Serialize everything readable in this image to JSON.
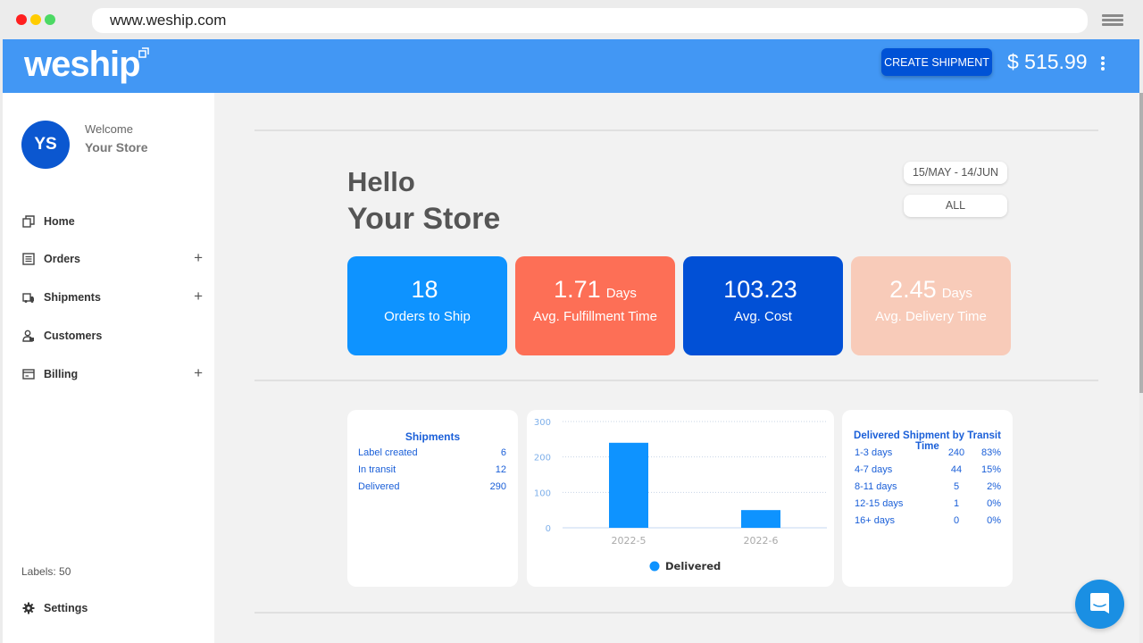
{
  "browser": {
    "url": "www.weship.com"
  },
  "appbar": {
    "logo": "weship",
    "create_shipment_label": "CREATE SHIPMENT",
    "balance": "$ 515.99"
  },
  "sidebar": {
    "avatar_initials": "YS",
    "welcome": "Welcome",
    "store_name": "Your Store",
    "items": [
      {
        "label": "Home",
        "icon": "home-icon",
        "expandable": false
      },
      {
        "label": "Orders",
        "icon": "orders-icon",
        "expandable": true
      },
      {
        "label": "Shipments",
        "icon": "truck-icon",
        "expandable": true
      },
      {
        "label": "Customers",
        "icon": "customers-icon",
        "expandable": false
      },
      {
        "label": "Billing",
        "icon": "billing-icon",
        "expandable": true
      }
    ],
    "expand_symbol": "+",
    "labels_count": "Labels: 50",
    "settings_label": "Settings"
  },
  "main": {
    "greeting": "Hello",
    "store_name": "Your Store",
    "date_range": "15/MAY - 14/JUN",
    "filter": "ALL",
    "stats": [
      {
        "value": "18",
        "unit": "",
        "label": "Orders to Ship",
        "color": "#0e93ff"
      },
      {
        "value": "1.71",
        "unit": "Days",
        "label": "Avg. Fulfillment Time",
        "color": "#fd6f56"
      },
      {
        "value": "103.23",
        "unit": "",
        "label": "Avg. Cost",
        "color": "#0150d6"
      },
      {
        "value": "2.45",
        "unit": "Days",
        "label": "Avg. Delivery Time",
        "color": "#f8cbb9"
      }
    ],
    "shipments_panel": {
      "title": "Shipments",
      "rows": [
        {
          "label": "Label created",
          "value": "6"
        },
        {
          "label": "In transit",
          "value": "12"
        },
        {
          "label": "Delivered",
          "value": "290"
        }
      ]
    },
    "transit_panel": {
      "title": "Delivered Shipment by Transit Time",
      "rows": [
        {
          "range": "1-3 days",
          "count": "240",
          "percent": "83%"
        },
        {
          "range": "4-7 days",
          "count": "44",
          "percent": "15%"
        },
        {
          "range": "8-11 days",
          "count": "5",
          "percent": "2%"
        },
        {
          "range": "12-15 days",
          "count": "1",
          "percent": "0%"
        },
        {
          "range": "16+ days",
          "count": "0",
          "percent": "0%"
        }
      ]
    }
  },
  "chart_data": {
    "type": "bar",
    "title": "",
    "categories": [
      "2022-5",
      "2022-6"
    ],
    "series": [
      {
        "name": "Delivered",
        "values": [
          240,
          50
        ],
        "color": "#0e93ff"
      }
    ],
    "yticks": [
      "0",
      "100",
      "200",
      "300"
    ],
    "ylim": [
      0,
      300
    ],
    "grid": true,
    "legend": "bottom",
    "xlabel": "",
    "ylabel": ""
  }
}
